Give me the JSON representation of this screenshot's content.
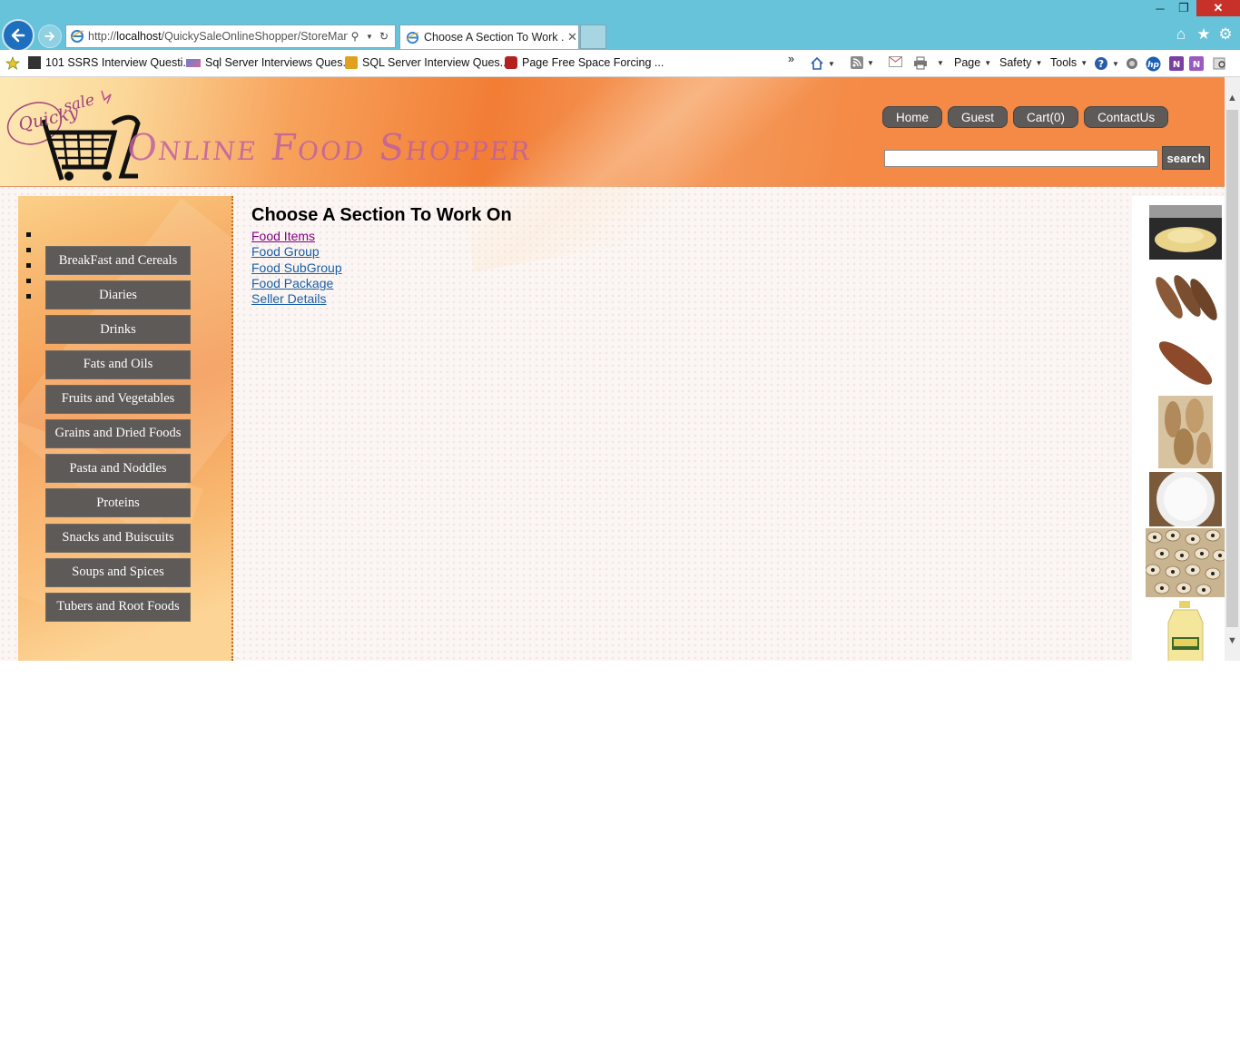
{
  "browser": {
    "url_prefix": "http://",
    "url_host": "localhost",
    "url_path": "/QuickySaleOnlineShopper/StoreMana",
    "tab_title": "Choose A Section To Work ...",
    "favorites": [
      "101 SSRS Interview Questi...",
      "Sql Server Interviews Ques...",
      "SQL Server Interview Ques...",
      "Page Free Space  Forcing ..."
    ],
    "chevron": "»",
    "commands": {
      "page": "Page",
      "safety": "Safety",
      "tools": "Tools"
    }
  },
  "site": {
    "logo": {
      "sale": "sale",
      "quicky": "Quicky",
      "name": "Online Food Shopper"
    },
    "nav": [
      "Home",
      "Guest",
      "Cart(0)",
      "ContactUs"
    ],
    "search": {
      "value": "",
      "button": "search"
    }
  },
  "categories": [
    "BreakFast and Cereals",
    "Diaries",
    "Drinks",
    "Fats and Oils",
    "Fruits and Vegetables",
    "Grains and Dried Foods",
    "Pasta and Noddles",
    "Proteins",
    "Snacks and Buiscuits",
    "Soups and Spices",
    "Tubers and Root Foods"
  ],
  "main": {
    "title": "Choose A Section To Work On",
    "links": [
      "Food Items",
      "Food Group",
      "Food SubGroup",
      "Food Package",
      "Seller Details"
    ]
  },
  "side_images": [
    "garri-flour",
    "yam-tubers",
    "cassava-root",
    "yam-pile",
    "white-flour-bowl",
    "black-eyed-beans",
    "wesson-oil-bottle"
  ]
}
